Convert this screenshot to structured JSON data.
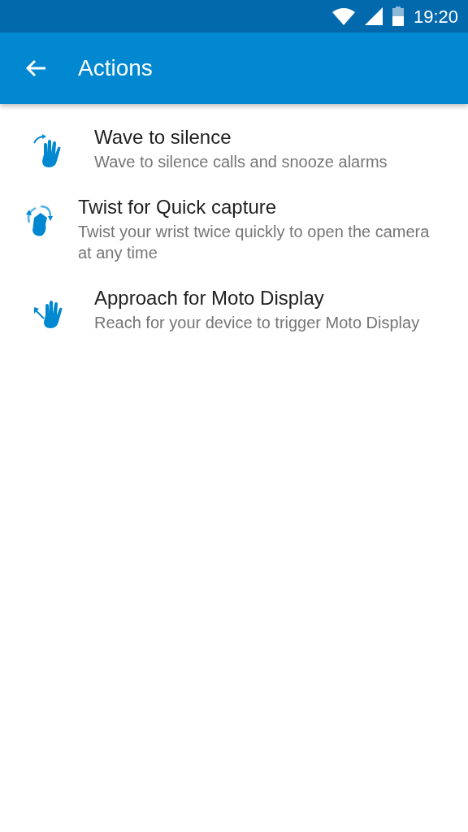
{
  "status_bar": {
    "time": "19:20"
  },
  "app_bar": {
    "title": "Actions"
  },
  "items": [
    {
      "kind": "wave",
      "title": "Wave to silence",
      "subtitle": "Wave to silence calls and snooze alarms"
    },
    {
      "kind": "twist",
      "title": "Twist for Quick capture",
      "subtitle": "Twist your wrist twice quickly to open the camera at any time"
    },
    {
      "kind": "approach",
      "title": "Approach for Moto Display",
      "subtitle": "Reach for your device to trigger Moto Display"
    }
  ]
}
